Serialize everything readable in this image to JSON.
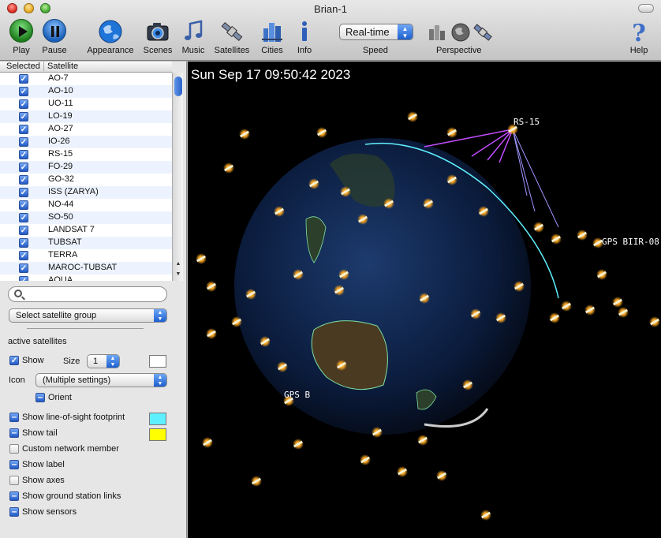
{
  "window": {
    "title": "Brian-1"
  },
  "toolbar": {
    "play": "Play",
    "pause": "Pause",
    "appearance": "Appearance",
    "scenes": "Scenes",
    "music": "Music",
    "satellites": "Satellites",
    "cities": "Cities",
    "info": "Info",
    "speed_value": "Real-time",
    "speed_label": "Speed",
    "perspective_label": "Perspective",
    "help": "Help"
  },
  "table": {
    "col_selected": "Selected",
    "col_satellite": "Satellite",
    "rows": [
      {
        "name": "AO-7",
        "selected": true
      },
      {
        "name": "AO-10",
        "selected": true
      },
      {
        "name": "UO-11",
        "selected": true
      },
      {
        "name": "LO-19",
        "selected": true
      },
      {
        "name": "AO-27",
        "selected": true
      },
      {
        "name": "IO-26",
        "selected": true
      },
      {
        "name": "RS-15",
        "selected": true
      },
      {
        "name": "FO-29",
        "selected": true
      },
      {
        "name": "GO-32",
        "selected": true
      },
      {
        "name": "ISS (ZARYA)",
        "selected": true
      },
      {
        "name": "NO-44",
        "selected": true
      },
      {
        "name": "SO-50",
        "selected": true
      },
      {
        "name": "LANDSAT 7",
        "selected": true
      },
      {
        "name": "TUBSAT",
        "selected": true
      },
      {
        "name": "TERRA",
        "selected": true
      },
      {
        "name": "MAROC-TUBSAT",
        "selected": true
      },
      {
        "name": "AQUA",
        "selected": true
      }
    ]
  },
  "search": {
    "placeholder": ""
  },
  "group_select": {
    "value": "Select satellite group"
  },
  "settings": {
    "section_title": "active satellites",
    "show_label": "Show",
    "size_label": "Size",
    "size_value": "1",
    "icon_label": "Icon",
    "icon_value": "(Multiple settings)",
    "orient": "Orient",
    "los_footprint": "Show line-of-sight footprint",
    "tail": "Show tail",
    "custom_network": "Custom network member",
    "label": "Show label",
    "axes": "Show axes",
    "ground_links": "Show ground station links",
    "sensors": "Show sensors"
  },
  "colors": {
    "show_color": "#ffffff",
    "footprint_color": "#5ff0ff",
    "tail_color": "#ffff00",
    "link_color": "#c34cff",
    "earth_ocean": "#0a1836"
  },
  "view": {
    "datetime": "Sun Sep 17 09:50:42 2023",
    "labels": {
      "rs15": "RS-15",
      "gps_biir": "GPS BIIR-08",
      "gps_b": "GPS B"
    }
  }
}
